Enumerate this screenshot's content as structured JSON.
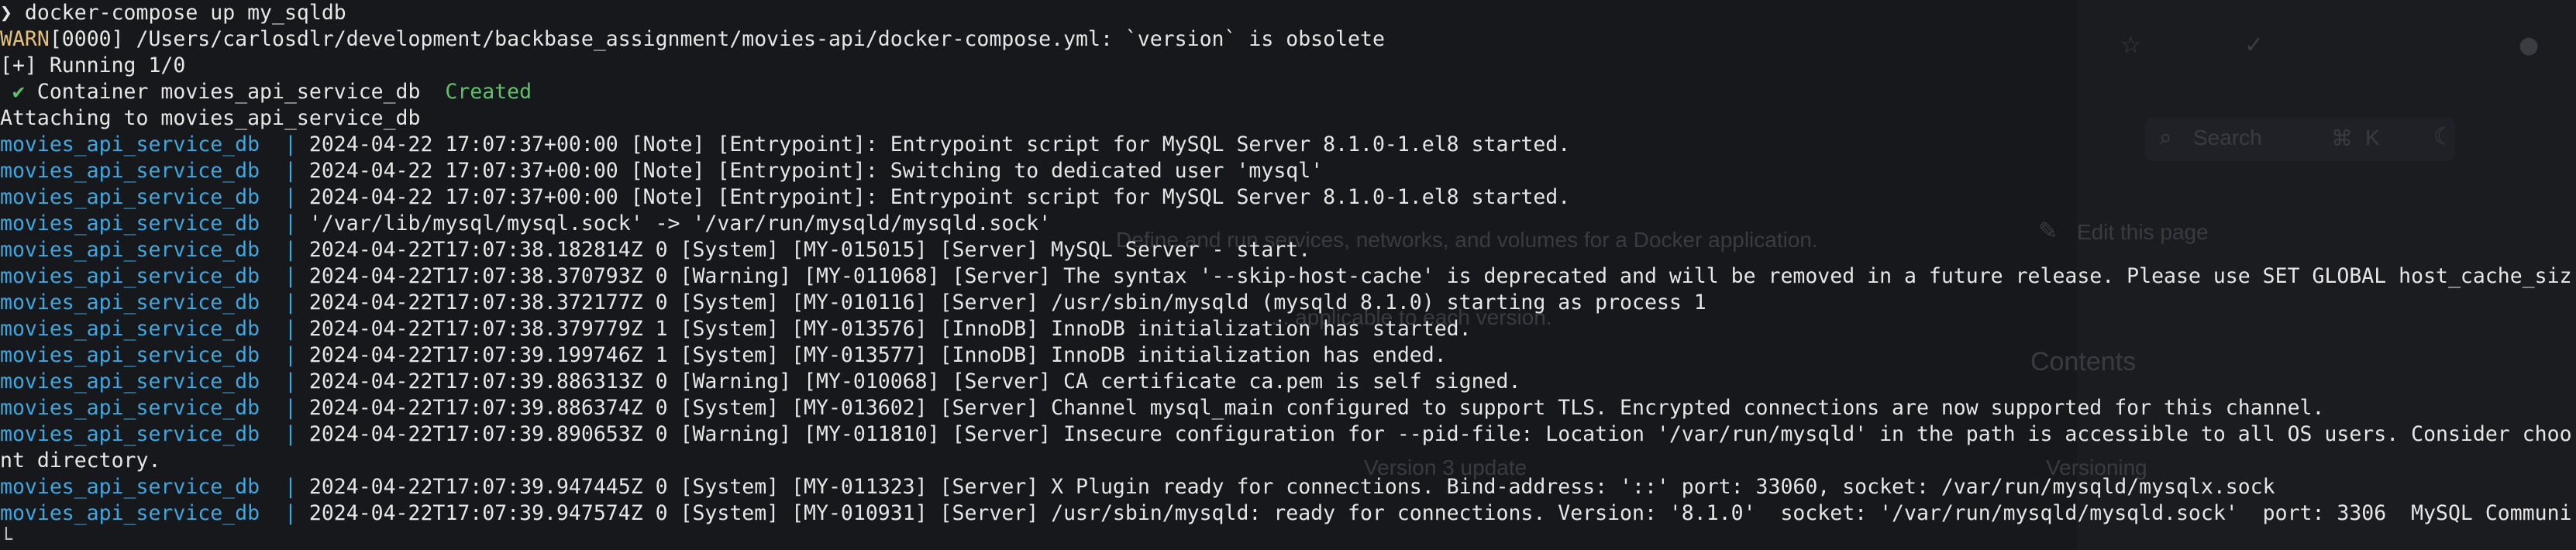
{
  "colors": {
    "background": "#17181c",
    "foreground": "#e6e6e6",
    "service_prefix": "#3fa7e0",
    "success": "#5ec26a",
    "warning": "#e5c07b"
  },
  "terminal": {
    "prompt_symbol": "❯",
    "command": " docker-compose up my_sqldb",
    "warn": {
      "label": "WARN",
      "text": "[0000] /Users/carlosdlr/development/backbase_assignment/movies-api/docker-compose.yml: `version` is obsolete"
    },
    "running": "[+] Running 1/0",
    "container": {
      "check": " ✔",
      "text": " Container movies_api_service_db  ",
      "status": "Created"
    },
    "attaching": "Attaching to movies_api_service_db",
    "service_prefix": "movies_api_service_db  ",
    "separator": "| ",
    "log_lines": [
      "2024-04-22 17:07:37+00:00 [Note] [Entrypoint]: Entrypoint script for MySQL Server 8.1.0-1.el8 started.",
      "2024-04-22 17:07:37+00:00 [Note] [Entrypoint]: Switching to dedicated user 'mysql'",
      "2024-04-22 17:07:37+00:00 [Note] [Entrypoint]: Entrypoint script for MySQL Server 8.1.0-1.el8 started.",
      "'/var/lib/mysql/mysql.sock' -> '/var/run/mysqld/mysqld.sock'",
      "2024-04-22T17:07:38.182814Z 0 [System] [MY-015015] [Server] MySQL Server - start.",
      "2024-04-22T17:07:38.370793Z 0 [Warning] [MY-011068] [Server] The syntax '--skip-host-cache' is deprecated and will be removed in a future release. Please use SET GLOBAL host_cache_siz",
      "2024-04-22T17:07:38.372177Z 0 [System] [MY-010116] [Server] /usr/sbin/mysqld (mysqld 8.1.0) starting as process 1",
      "2024-04-22T17:07:38.379779Z 1 [System] [MY-013576] [InnoDB] InnoDB initialization has started.",
      "2024-04-22T17:07:39.199746Z 1 [System] [MY-013577] [InnoDB] InnoDB initialization has ended.",
      "2024-04-22T17:07:39.886313Z 0 [Warning] [MY-010068] [Server] CA certificate ca.pem is self signed.",
      "2024-04-22T17:07:39.886374Z 0 [System] [MY-013602] [Server] Channel mysql_main configured to support TLS. Encrypted connections are now supported for this channel.",
      "2024-04-22T17:07:39.890653Z 0 [Warning] [MY-011810] [Server] Insecure configuration for --pid-file: Location '/var/run/mysqld' in the path is accessible to all OS users. Consider choo"
    ],
    "wrap_line": "nt directory.",
    "final_log_lines": [
      "2024-04-22T17:07:39.947445Z 0 [System] [MY-011323] [Server] X Plugin ready for connections. Bind-address: '::' port: 33060, socket: /var/run/mysqld/mysqlx.sock",
      "2024-04-22T17:07:39.947574Z 0 [System] [MY-010931] [Server] /usr/sbin/mysqld: ready for connections. Version: '8.1.0'  socket: '/var/run/mysqld/mysqld.sock'  port: 3306  MySQL Communi"
    ],
    "cursor": "└"
  },
  "background_window": {
    "search_label": "Search",
    "shortcut_keys": [
      "⌘",
      "K"
    ],
    "edit_link": "Edit this page",
    "contents_heading": "Contents",
    "description": "Define and run services, networks, and volumes for a Docker application.",
    "sub_description": "... applicable to each version.",
    "section_versioning": "Versioning",
    "section_version_update": "Version 3 update"
  }
}
